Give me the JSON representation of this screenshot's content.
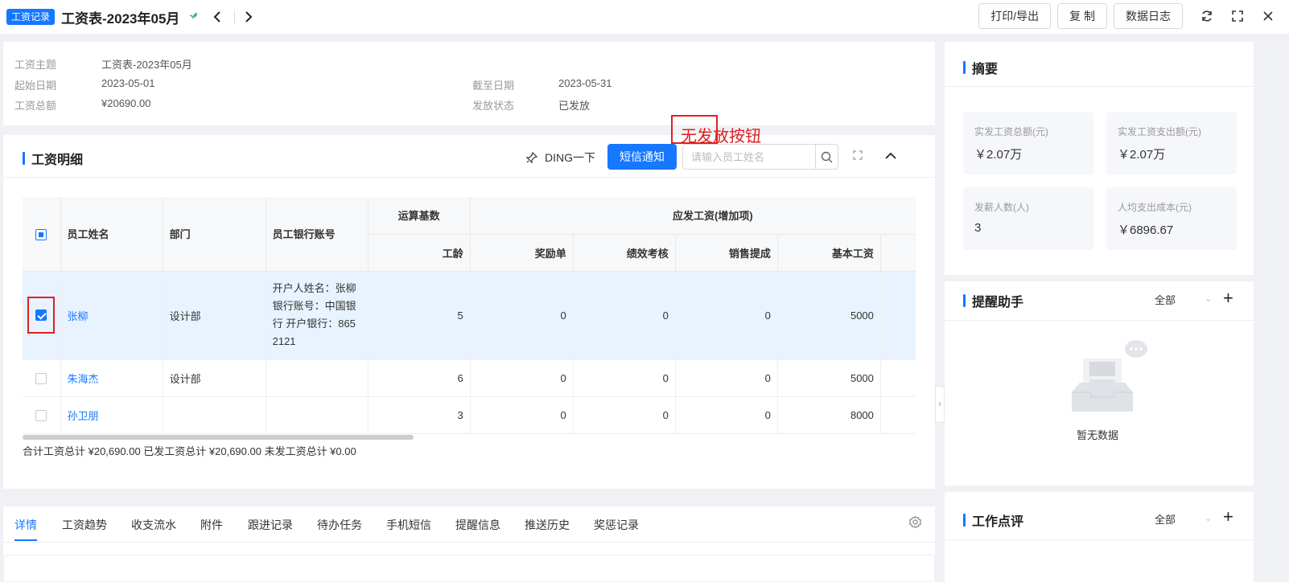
{
  "header": {
    "badge": "工资记录",
    "title": "工资表-2023年05月",
    "buttons": {
      "print": "打印/导出",
      "copy": "复 制",
      "log": "数据日志"
    }
  },
  "info": {
    "subject_label": "工资主题",
    "subject": "工资表-2023年05月",
    "start_label": "起始日期",
    "start": "2023-05-01",
    "end_label": "截至日期",
    "end": "2023-05-31",
    "total_label": "工资总额",
    "total": "¥20690.00",
    "status_label": "发放状态",
    "status": "已发放"
  },
  "detail": {
    "title": "工资明细",
    "ding": "DING一下",
    "sms": "短信通知",
    "search_placeholder": "请输入员工姓名",
    "annotation": "无发放按钮",
    "columns": {
      "name": "员工姓名",
      "dept": "部门",
      "bank": "员工银行账号",
      "base_group": "运算基数",
      "add_group": "应发工资(增加项)",
      "seniority": "工龄",
      "bonus": "奖励单",
      "perf": "绩效考核",
      "sales": "销售提成",
      "basic": "基本工资"
    },
    "rows": [
      {
        "name": "张柳",
        "dept": "设计部",
        "bank": [
          "开户人姓名：张柳",
          "银行账号：中国银",
          "行 开户银行：865",
          "2121"
        ],
        "seniority": "5",
        "bonus": "0",
        "perf": "0",
        "sales": "0",
        "basic": "5000"
      },
      {
        "name": "朱海杰",
        "dept": "设计部",
        "bank": [],
        "seniority": "6",
        "bonus": "0",
        "perf": "0",
        "sales": "0",
        "basic": "5000"
      },
      {
        "name": "孙卫朋",
        "dept": "",
        "bank": [],
        "seniority": "3",
        "bonus": "0",
        "perf": "0",
        "sales": "0",
        "basic": "8000"
      }
    ],
    "totals": "合计工资总计 ¥20,690.00 已发工资总计 ¥20,690.00 未发工资总计 ¥0.00"
  },
  "tabs": [
    "详情",
    "工资趋势",
    "收支流水",
    "附件",
    "跟进记录",
    "待办任务",
    "手机短信",
    "提醒信息",
    "推送历史",
    "奖惩记录"
  ],
  "summary": {
    "title": "摘要",
    "stats": [
      {
        "label": "实发工资总额(元)",
        "value": "￥2.07万"
      },
      {
        "label": "实发工资支出额(元)",
        "value": "￥2.07万"
      },
      {
        "label": "发薪人数(人)",
        "value": "3"
      },
      {
        "label": "人均支出成本(元)",
        "value": "￥6896.67"
      }
    ]
  },
  "reminder": {
    "title": "提醒助手",
    "filter": "全部",
    "empty": "暂无数据"
  },
  "review": {
    "title": "工作点评",
    "filter": "全部"
  },
  "colors": {
    "accent": "#1677ff",
    "annotation": "#e02020"
  }
}
